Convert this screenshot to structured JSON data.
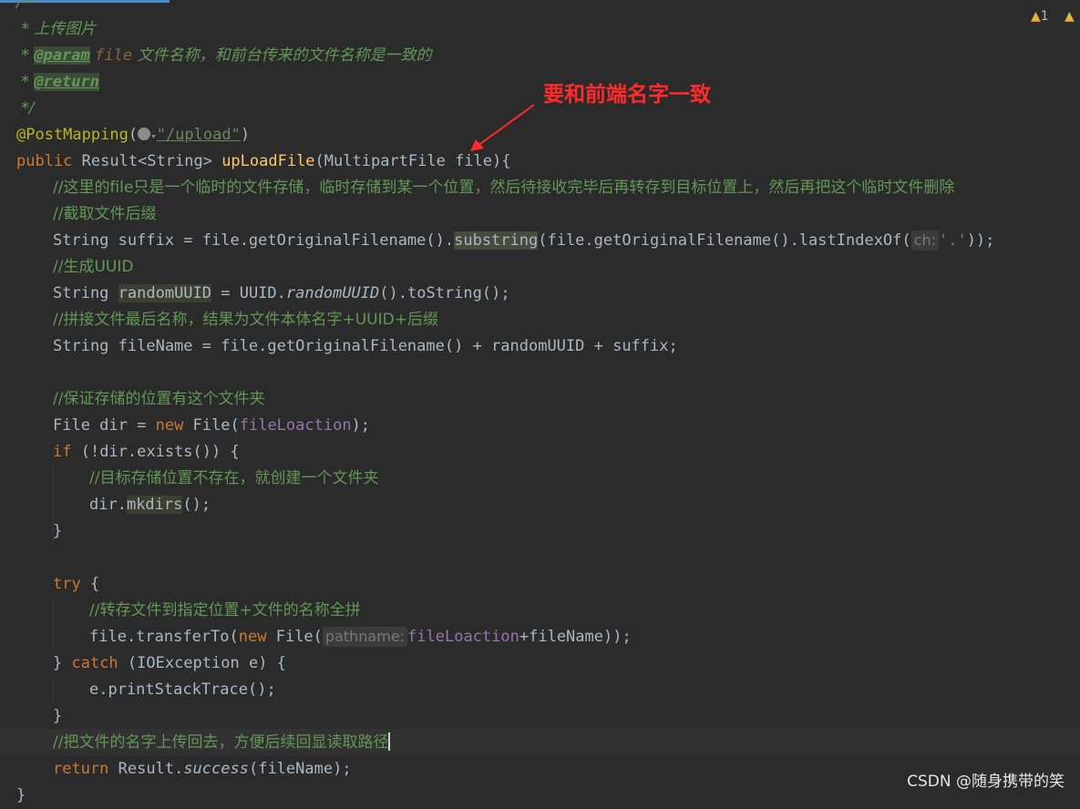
{
  "warnings": {
    "count": "1"
  },
  "annotation": {
    "text": "要和前端名字一致",
    "color": "#ff2a2a"
  },
  "watermark": "CSDN @随身携带的笑",
  "code": {
    "doc_open": "/**",
    "doc_title": " * 上传图片",
    "doc_star": " * ",
    "doc_param_tag": "@param",
    "doc_param_name": "file",
    "doc_param_desc": " 文件名称，和前台传来的文件名称是一致的",
    "doc_return_tag": "@return",
    "doc_close": " */",
    "mapping_annotation": "@PostMapping",
    "mapping_path": "\"/upload\"",
    "kw_public": "public",
    "return_type": " Result<String> ",
    "method_name": "upLoadFile",
    "method_params": "(MultipartFile file){",
    "c1": "//这里的file只是一个临时的文件存储，临时存储到某一个位置，然后待接收完毕后再转存到目标位置上，然后再把这个临时文件删除",
    "c2": "//截取文件后缀",
    "l_suffix_a": "String suffix = file.getOriginalFilename().",
    "l_suffix_sub": "substring",
    "l_suffix_b": "(file.getOriginalFilename().lastIndexOf(",
    "hint_ch": "ch:",
    "l_suffix_c": "'.'",
    "l_suffix_d": "));",
    "c3": "//生成UUID",
    "l_uuid_a": "String ",
    "l_uuid_var": "randomUUID",
    "l_uuid_b": " = UUID.",
    "l_uuid_m": "randomUUID",
    "l_uuid_c": "().toString();",
    "c4": "//拼接文件最后名称，结果为文件本体名字+UUID+后缀",
    "l_name": "String fileName = file.getOriginalFilename() + randomUUID + suffix;",
    "c5": "//保证存储的位置有这个文件夹",
    "l_dir_a": "File dir = ",
    "kw_new": "new",
    "l_dir_b": " File(",
    "field_loc": "fileLoaction",
    "l_dir_c": ");",
    "kw_if": "if",
    "l_if": " (!dir.exists()) {",
    "c6": "//目标存储位置不存在，就创建一个文件夹",
    "l_mk_a": "dir.",
    "l_mk_m": "mkdirs",
    "l_mk_b": "();",
    "brace_close": "}",
    "kw_try": "try",
    "l_try": " {",
    "c7": "//转存文件到指定位置+文件的名称全拼",
    "l_tr_a": "file.transferTo(",
    "l_tr_b": " File(",
    "hint_path": "pathname:",
    "l_tr_c": "+fileName));",
    "l_catch_a": "} ",
    "kw_catch": "catch",
    "l_catch_b": " (IOException e) {",
    "l_pst": "e.printStackTrace();",
    "c8": "//把文件的名字上传回去，方便后续回显读取路径",
    "kw_return": "return",
    "l_ret_a": " Result.",
    "l_ret_m": "success",
    "l_ret_b": "(fileName);"
  }
}
